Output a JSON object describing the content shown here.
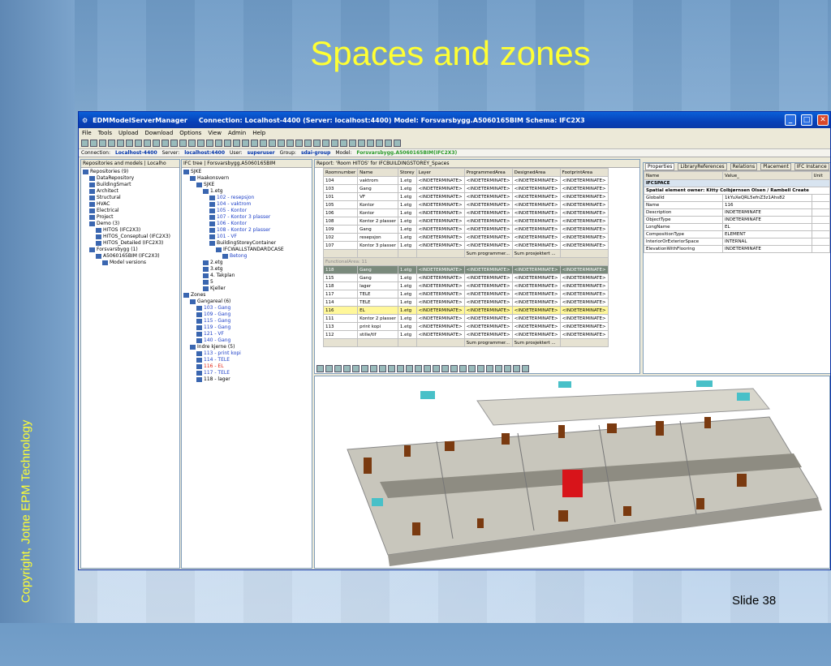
{
  "slide": {
    "title": "Spaces and zones",
    "copyright": "Copyright, Jotne EPM Technology",
    "slide_number": "Slide 38"
  },
  "window": {
    "title": "EDMModelServerManager",
    "connection_info": "Connection: Localhost-4400  (Server: localhost:4400)  Model: Forsvarsbygg.A5060165BIM  Schema: IFC2X3"
  },
  "menu": [
    "File",
    "Tools",
    "Upload",
    "Download",
    "Options",
    "View",
    "Admin",
    "Help"
  ],
  "connbar": {
    "connection_label": "Connection:",
    "connection": "Localhost-4400",
    "server_label": "Server:",
    "server": "localhost:4400",
    "user_label": "User:",
    "user": "superuser",
    "group_label": "Group:",
    "group": "sdai-group",
    "model_label": "Model:",
    "model": "Forsvarsbygg.A5060165BIM(IFC2X3)"
  },
  "left_panel": {
    "header": "Repositories and models  |  Localho",
    "items": [
      {
        "t": "Repositories (9)",
        "lvl": 0
      },
      {
        "t": "DataRepository",
        "lvl": 1
      },
      {
        "t": "BuildingSmart",
        "lvl": 1
      },
      {
        "t": "Architect",
        "lvl": 1
      },
      {
        "t": "Structural",
        "lvl": 1
      },
      {
        "t": "HVAC",
        "lvl": 1
      },
      {
        "t": "Electrical",
        "lvl": 1
      },
      {
        "t": "Project",
        "lvl": 1
      },
      {
        "t": "Demo (3)",
        "lvl": 1
      },
      {
        "t": "HITOS (IFC2X3)",
        "lvl": 2
      },
      {
        "t": "HITOS_Conseptual (IFC2X3)",
        "lvl": 2
      },
      {
        "t": "HITOS_Detailed (IFC2X3)",
        "lvl": 2
      },
      {
        "t": "Forsvarsbygg (1)",
        "lvl": 1
      },
      {
        "t": "A5060165BIM (IFC2X3)",
        "lvl": 2
      },
      {
        "t": "Model versions",
        "lvl": 3
      }
    ]
  },
  "ifc_tree": {
    "header": "IFC tree  |  Forsvarsbygg.A5060165BIM",
    "items": [
      {
        "t": "SJKE",
        "lvl": 0,
        "c": ""
      },
      {
        "t": "Haakonsvern",
        "lvl": 1,
        "c": ""
      },
      {
        "t": "SJKE",
        "lvl": 2,
        "c": ""
      },
      {
        "t": "1.etg",
        "lvl": 3,
        "c": ""
      },
      {
        "t": "102 - resepsjon",
        "lvl": 4,
        "c": "blue"
      },
      {
        "t": "104 - vaktrom",
        "lvl": 4,
        "c": "blue"
      },
      {
        "t": "105 - Kontor",
        "lvl": 4,
        "c": "blue"
      },
      {
        "t": "107 - Kontor 3 plasser",
        "lvl": 4,
        "c": "blue"
      },
      {
        "t": "106 - Kontor",
        "lvl": 4,
        "c": "blue"
      },
      {
        "t": "108 - Kontor 2 plasser",
        "lvl": 4,
        "c": "blue"
      },
      {
        "t": "101 - VF",
        "lvl": 4,
        "c": "blue"
      },
      {
        "t": "BuildingStoreyContainer",
        "lvl": 4,
        "c": ""
      },
      {
        "t": "IFCWALLSTANDARDCASE",
        "lvl": 5,
        "c": ""
      },
      {
        "t": "Betong",
        "lvl": 6,
        "c": "blue"
      },
      {
        "t": "2.etg",
        "lvl": 3,
        "c": ""
      },
      {
        "t": "3.etg",
        "lvl": 3,
        "c": ""
      },
      {
        "t": "4. Takplan",
        "lvl": 3,
        "c": ""
      },
      {
        "t": "5",
        "lvl": 3,
        "c": ""
      },
      {
        "t": "Kjeller",
        "lvl": 3,
        "c": ""
      },
      {
        "t": "Zones",
        "lvl": 0,
        "c": ""
      },
      {
        "t": "Gangareal (6)",
        "lvl": 1,
        "c": ""
      },
      {
        "t": "103 - Gang",
        "lvl": 2,
        "c": "blue"
      },
      {
        "t": "109 - Gang",
        "lvl": 2,
        "c": "blue"
      },
      {
        "t": "115 - Gang",
        "lvl": 2,
        "c": "blue"
      },
      {
        "t": "119 - Gang",
        "lvl": 2,
        "c": "blue"
      },
      {
        "t": "121 - VF",
        "lvl": 2,
        "c": "blue"
      },
      {
        "t": "140 - Gang",
        "lvl": 2,
        "c": "blue"
      },
      {
        "t": "Indre kjerne (5)",
        "lvl": 1,
        "c": ""
      },
      {
        "t": "113 - print kopi",
        "lvl": 2,
        "c": "blue"
      },
      {
        "t": "114 - TELE",
        "lvl": 2,
        "c": "blue"
      },
      {
        "t": "116 - EL",
        "lvl": 2,
        "c": "red"
      },
      {
        "t": "117 - TELE",
        "lvl": 2,
        "c": "blue"
      },
      {
        "t": "118 - lager",
        "lvl": 2,
        "c": ""
      }
    ]
  },
  "report": {
    "header": "Report: 'Room HITOS' for IFCBUILDINGSTOREY_Spaces",
    "columns": [
      "Roomnumber",
      "Name",
      "Storey",
      "Layer",
      "ProgrammedArea",
      "DesignedArea",
      "FootprintArea"
    ],
    "rows1": [
      [
        "104",
        "vaktrom",
        "1.etg",
        "<INDETERMINATE>",
        "<INDETERMINATE>",
        "<INDETERMINATE>",
        "<INDETERMINATE>"
      ],
      [
        "103",
        "Gang",
        "1.etg",
        "<INDETERMINATE>",
        "<INDETERMINATE>",
        "<INDETERMINATE>",
        "<INDETERMINATE>"
      ],
      [
        "101",
        "VF",
        "1.etg",
        "<INDETERMINATE>",
        "<INDETERMINATE>",
        "<INDETERMINATE>",
        "<INDETERMINATE>"
      ],
      [
        "105",
        "Kontor",
        "1.etg",
        "<INDETERMINATE>",
        "<INDETERMINATE>",
        "<INDETERMINATE>",
        "<INDETERMINATE>"
      ],
      [
        "106",
        "Kontor",
        "1.etg",
        "<INDETERMINATE>",
        "<INDETERMINATE>",
        "<INDETERMINATE>",
        "<INDETERMINATE>"
      ],
      [
        "108",
        "Kontor 2 plasser",
        "1.etg",
        "<INDETERMINATE>",
        "<INDETERMINATE>",
        "<INDETERMINATE>",
        "<INDETERMINATE>"
      ],
      [
        "109",
        "Gang",
        "1.etg",
        "<INDETERMINATE>",
        "<INDETERMINATE>",
        "<INDETERMINATE>",
        "<INDETERMINATE>"
      ],
      [
        "102",
        "resepsjon",
        "1.etg",
        "<INDETERMINATE>",
        "<INDETERMINATE>",
        "<INDETERMINATE>",
        "<INDETERMINATE>"
      ],
      [
        "107",
        "Kontor 3 plasser",
        "1.etg",
        "<INDETERMINATE>",
        "<INDETERMINATE>",
        "<INDETERMINATE>",
        "<INDETERMINATE>"
      ]
    ],
    "sum1": [
      "Sum programmer...",
      "Sum prosjektert ..."
    ],
    "group2": "FunctionalArea: 11",
    "rows2": [
      [
        "118",
        "Gang",
        "1.etg",
        "<INDETERMINATE>",
        "<INDETERMINATE>",
        "<INDETERMINATE>",
        "<INDETERMINATE>"
      ],
      [
        "115",
        "Gang",
        "1.etg",
        "<INDETERMINATE>",
        "<INDETERMINATE>",
        "<INDETERMINATE>",
        "<INDETERMINATE>"
      ],
      [
        "118",
        "lager",
        "1.etg",
        "<INDETERMINATE>",
        "<INDETERMINATE>",
        "<INDETERMINATE>",
        "<INDETERMINATE>"
      ],
      [
        "117",
        "TELE",
        "1.etg",
        "<INDETERMINATE>",
        "<INDETERMINATE>",
        "<INDETERMINATE>",
        "<INDETERMINATE>"
      ],
      [
        "114",
        "TELE",
        "1.etg",
        "<INDETERMINATE>",
        "<INDETERMINATE>",
        "<INDETERMINATE>",
        "<INDETERMINATE>"
      ],
      [
        "116",
        "EL",
        "1.etg",
        "<INDETERMINATE>",
        "<INDETERMINATE>",
        "<INDETERMINATE>",
        "<INDETERMINATE>"
      ],
      [
        "111",
        "Kontor 2 plasser",
        "1.etg",
        "<INDETERMINATE>",
        "<INDETERMINATE>",
        "<INDETERMINATE>",
        "<INDETERMINATE>"
      ],
      [
        "113",
        "print kopi",
        "1.etg",
        "<INDETERMINATE>",
        "<INDETERMINATE>",
        "<INDETERMINATE>",
        "<INDETERMINATE>"
      ],
      [
        "112",
        "stille/tlf",
        "1.etg",
        "<INDETERMINATE>",
        "<INDETERMINATE>",
        "<INDETERMINATE>",
        "<INDETERMINATE>"
      ]
    ],
    "sum2": [
      "Sum programmer...",
      "Sum prosjektert ..."
    ]
  },
  "properties": {
    "tabs": [
      "Properties",
      "LibraryReferences",
      "Relations",
      "Placement",
      "IFC Instance"
    ],
    "columns": [
      "Name",
      "Value_",
      "Unit"
    ],
    "section": "IFCSPACE",
    "owner": "Spatial element owner: Kitty Colbjørnsen  Olsen / Rambell  Create",
    "rows": [
      [
        "GlobalId",
        "1kYuXeQRL5efnZ3z1Ahs82"
      ],
      [
        "Name",
        "116"
      ],
      [
        "Description",
        "INDETERMINATE"
      ],
      [
        "ObjectType",
        "INDETERMINATE"
      ],
      [
        "LongName",
        "EL"
      ],
      [
        "CompositionType",
        "ELEMENT"
      ],
      [
        "InteriorOrExteriorSpace",
        "INTERNAL"
      ],
      [
        "ElevationWithFlooring",
        "INDETERMINATE"
      ]
    ]
  }
}
